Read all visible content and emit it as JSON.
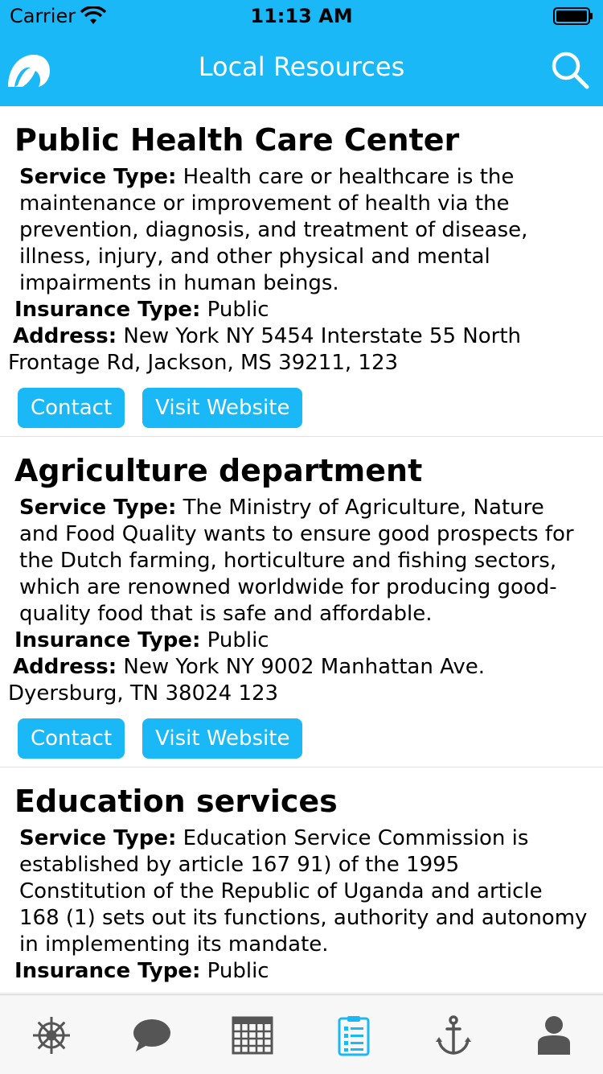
{
  "status": {
    "carrier": "Carrier",
    "time": "11:13 AM"
  },
  "nav": {
    "title": "Local Resources"
  },
  "resources": [
    {
      "name": "Public Health Care Center",
      "service_label": "Service Type:",
      "service": "Health care or healthcare is the maintenance or improvement of health via the prevention, diagnosis, and treatment of disease, illness, injury, and other physical and mental impairments in human beings.",
      "insurance_label": "Insurance Type:",
      "insurance": "Public",
      "address_label": "Address:",
      "address": "New York  NY  5454 Interstate 55 North Frontage Rd, Jackson, MS 39211,  123",
      "contact_label": "Contact",
      "website_label": "Visit Website"
    },
    {
      "name": "Agriculture department",
      "service_label": "Service Type:",
      "service": "The Ministry of Agriculture, Nature and Food Quality wants to ensure good prospects for the Dutch farming, horticulture and fishing sectors, which are renowned worldwide for producing good-quality food that is safe and affordable.",
      "insurance_label": "Insurance Type:",
      "insurance": "Public",
      "address_label": "Address:",
      "address": "New York  NY  9002 Manhattan Ave. Dyersburg, TN 38024  123",
      "contact_label": "Contact",
      "website_label": "Visit Website"
    },
    {
      "name": "Education services",
      "service_label": "Service Type:",
      "service": "Education Service Commission is established by article 167 91) of the 1995 Constitution of the Republic of Uganda and article 168 (1) sets out its functions, authority and autonomy in implementing its mandate.",
      "insurance_label": "Insurance Type:",
      "insurance": "Public"
    }
  ],
  "tabbar": {
    "items": [
      "helm-icon",
      "chat-bubble-icon",
      "calendar-icon",
      "clipboard-list-icon",
      "anchor-icon",
      "user-icon"
    ],
    "active_index": 3,
    "active_color": "#1ab8f6",
    "inactive_color": "#555555"
  },
  "colors": {
    "accent": "#1ab8f6"
  }
}
